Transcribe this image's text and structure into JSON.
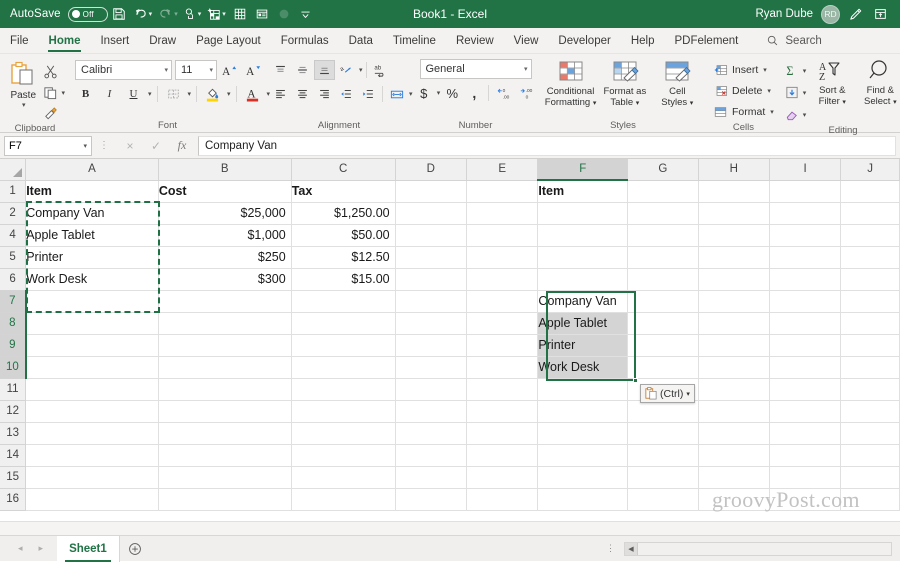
{
  "titlebar": {
    "autosave_label": "AutoSave",
    "autosave_state": "Off",
    "document_title": "Book1  -  Excel",
    "user_name": "Ryan Dube",
    "user_initials": "RD",
    "qat": [
      {
        "name": "save-icon",
        "label": "Save"
      },
      {
        "name": "undo-icon",
        "label": "Undo"
      },
      {
        "name": "redo-icon",
        "label": "Redo"
      },
      {
        "name": "touch-mode-icon",
        "label": "Touch/Mouse Mode"
      },
      {
        "name": "new-icon",
        "label": "New"
      },
      {
        "name": "calculate-icon",
        "label": "Calculate Now"
      },
      {
        "name": "form-icon",
        "label": "Form"
      },
      {
        "name": "record-macro-icon",
        "label": "Record Macro"
      },
      {
        "name": "customize-qat-icon",
        "label": "Customize Quick Access Toolbar"
      }
    ],
    "brand_color": "#217346"
  },
  "tabs": {
    "items": [
      {
        "label": "File",
        "active": false
      },
      {
        "label": "Home",
        "active": true
      },
      {
        "label": "Insert",
        "active": false
      },
      {
        "label": "Draw",
        "active": false
      },
      {
        "label": "Page Layout",
        "active": false
      },
      {
        "label": "Formulas",
        "active": false
      },
      {
        "label": "Data",
        "active": false
      },
      {
        "label": "Timeline",
        "active": false
      },
      {
        "label": "Review",
        "active": false
      },
      {
        "label": "View",
        "active": false
      },
      {
        "label": "Developer",
        "active": false
      },
      {
        "label": "Help",
        "active": false
      },
      {
        "label": "PDFelement",
        "active": false
      }
    ],
    "search_placeholder": "Search"
  },
  "ribbon": {
    "groups": {
      "clipboard": {
        "label": "Clipboard",
        "paste_label": "Paste",
        "cut_label": "Cut",
        "copy_label": "Copy",
        "format_painter_label": "Format Painter"
      },
      "font": {
        "label": "Font",
        "font_name": "Calibri",
        "font_size": "11",
        "grow_label": "A",
        "shrink_label": "A",
        "bold_label": "B",
        "italic_label": "I",
        "underline_label": "U",
        "borders_label": "Borders",
        "fill_color_label": "Fill Color",
        "font_color_label": "A"
      },
      "alignment": {
        "label": "Alignment",
        "orientation_label": "Orientation",
        "wrap_text_label": "Wrap Text",
        "merge_label": "Merge & Center"
      },
      "number": {
        "label": "Number",
        "format": "General",
        "currency_label": "$",
        "percent_label": "%",
        "comma_label": ",",
        "increase_decimal_label": "Increase Decimal",
        "decrease_decimal_label": "Decrease Decimal"
      },
      "styles": {
        "label": "Styles",
        "items": [
          {
            "line1": "Conditional",
            "line2": "Formatting",
            "caret": true
          },
          {
            "line1": "Format as",
            "line2": "Table",
            "caret": true
          },
          {
            "line1": "Cell",
            "line2": "Styles",
            "caret": true
          }
        ]
      },
      "cells": {
        "label": "Cells",
        "items": [
          {
            "label": "Insert",
            "caret": true
          },
          {
            "label": "Delete",
            "caret": true
          },
          {
            "label": "Format",
            "caret": true
          }
        ]
      },
      "editing": {
        "label": "Editing",
        "autosum_label": "AutoSum",
        "fill_label": "Fill",
        "clear_label": "Clear",
        "sort_line1": "Sort &",
        "sort_line2": "Filter",
        "find_line1": "Find &",
        "find_line2": "Select"
      }
    }
  },
  "formula_bar": {
    "name_box": "F7",
    "cancel_label": "×",
    "enter_label": "✓",
    "fx_label": "fx",
    "formula_value": "Company Van"
  },
  "sheet": {
    "columns": [
      {
        "label": "A",
        "width": 134,
        "selected": false
      },
      {
        "label": "B",
        "width": 135,
        "selected": false
      },
      {
        "label": "C",
        "width": 105,
        "selected": false
      },
      {
        "label": "D",
        "width": 73,
        "selected": false
      },
      {
        "label": "E",
        "width": 73,
        "selected": false
      },
      {
        "label": "F",
        "width": 90,
        "selected": true
      },
      {
        "label": "G",
        "width": 72,
        "selected": false
      },
      {
        "label": "H",
        "width": 73,
        "selected": false
      },
      {
        "label": "I",
        "width": 73,
        "selected": false
      },
      {
        "label": "J",
        "width": 60,
        "selected": false
      }
    ],
    "rows": [
      {
        "number": "1",
        "selected": false,
        "cells": [
          {
            "v": "Item",
            "bold": true
          },
          {
            "v": "Cost",
            "bold": true
          },
          {
            "v": "Tax",
            "bold": true
          },
          {
            "v": ""
          },
          {
            "v": ""
          },
          {
            "v": "Item",
            "bold": true
          },
          {
            "v": ""
          },
          {
            "v": ""
          },
          {
            "v": ""
          },
          {
            "v": ""
          }
        ]
      },
      {
        "number": "2",
        "selected": false,
        "cells": [
          {
            "v": "Company Van"
          },
          {
            "v": "$25,000",
            "align": "right"
          },
          {
            "v": "$1,250.00",
            "align": "right"
          },
          {
            "v": ""
          },
          {
            "v": ""
          },
          {
            "v": ""
          },
          {
            "v": ""
          },
          {
            "v": ""
          },
          {
            "v": ""
          },
          {
            "v": ""
          }
        ]
      },
      {
        "number": "4",
        "selected": false,
        "cells": [
          {
            "v": "Apple Tablet"
          },
          {
            "v": "$1,000",
            "align": "right"
          },
          {
            "v": "$50.00",
            "align": "right"
          },
          {
            "v": ""
          },
          {
            "v": ""
          },
          {
            "v": ""
          },
          {
            "v": ""
          },
          {
            "v": ""
          },
          {
            "v": ""
          },
          {
            "v": ""
          }
        ]
      },
      {
        "number": "5",
        "selected": false,
        "cells": [
          {
            "v": "Printer"
          },
          {
            "v": "$250",
            "align": "right"
          },
          {
            "v": "$12.50",
            "align": "right"
          },
          {
            "v": ""
          },
          {
            "v": ""
          },
          {
            "v": ""
          },
          {
            "v": ""
          },
          {
            "v": ""
          },
          {
            "v": ""
          },
          {
            "v": ""
          }
        ]
      },
      {
        "number": "6",
        "selected": false,
        "cells": [
          {
            "v": "Work Desk"
          },
          {
            "v": "$300",
            "align": "right"
          },
          {
            "v": "$15.00",
            "align": "right"
          },
          {
            "v": ""
          },
          {
            "v": ""
          },
          {
            "v": ""
          },
          {
            "v": ""
          },
          {
            "v": ""
          },
          {
            "v": ""
          },
          {
            "v": ""
          }
        ]
      },
      {
        "number": "7",
        "selected": true,
        "cells": [
          {
            "v": ""
          },
          {
            "v": ""
          },
          {
            "v": ""
          },
          {
            "v": ""
          },
          {
            "v": ""
          },
          {
            "v": "Company Van"
          },
          {
            "v": ""
          },
          {
            "v": ""
          },
          {
            "v": ""
          },
          {
            "v": ""
          }
        ]
      },
      {
        "number": "8",
        "selected": true,
        "cells": [
          {
            "v": ""
          },
          {
            "v": ""
          },
          {
            "v": ""
          },
          {
            "v": ""
          },
          {
            "v": ""
          },
          {
            "v": "Apple Tablet",
            "hl": true
          },
          {
            "v": ""
          },
          {
            "v": ""
          },
          {
            "v": ""
          },
          {
            "v": ""
          }
        ]
      },
      {
        "number": "9",
        "selected": true,
        "cells": [
          {
            "v": ""
          },
          {
            "v": ""
          },
          {
            "v": ""
          },
          {
            "v": ""
          },
          {
            "v": ""
          },
          {
            "v": "Printer",
            "hl": true
          },
          {
            "v": ""
          },
          {
            "v": ""
          },
          {
            "v": ""
          },
          {
            "v": ""
          }
        ]
      },
      {
        "number": "10",
        "selected": true,
        "cells": [
          {
            "v": ""
          },
          {
            "v": ""
          },
          {
            "v": ""
          },
          {
            "v": ""
          },
          {
            "v": ""
          },
          {
            "v": "Work Desk",
            "hl": true
          },
          {
            "v": ""
          },
          {
            "v": ""
          },
          {
            "v": ""
          },
          {
            "v": ""
          }
        ]
      },
      {
        "number": "11",
        "selected": false,
        "cells": [
          {
            "v": ""
          },
          {
            "v": ""
          },
          {
            "v": ""
          },
          {
            "v": ""
          },
          {
            "v": ""
          },
          {
            "v": ""
          },
          {
            "v": ""
          },
          {
            "v": ""
          },
          {
            "v": ""
          },
          {
            "v": ""
          }
        ]
      },
      {
        "number": "12",
        "selected": false,
        "cells": [
          {
            "v": ""
          },
          {
            "v": ""
          },
          {
            "v": ""
          },
          {
            "v": ""
          },
          {
            "v": ""
          },
          {
            "v": ""
          },
          {
            "v": ""
          },
          {
            "v": ""
          },
          {
            "v": ""
          },
          {
            "v": ""
          }
        ]
      },
      {
        "number": "13",
        "selected": false,
        "cells": [
          {
            "v": ""
          },
          {
            "v": ""
          },
          {
            "v": ""
          },
          {
            "v": ""
          },
          {
            "v": ""
          },
          {
            "v": ""
          },
          {
            "v": ""
          },
          {
            "v": ""
          },
          {
            "v": ""
          },
          {
            "v": ""
          }
        ]
      },
      {
        "number": "14",
        "selected": false,
        "cells": [
          {
            "v": ""
          },
          {
            "v": ""
          },
          {
            "v": ""
          },
          {
            "v": ""
          },
          {
            "v": ""
          },
          {
            "v": ""
          },
          {
            "v": ""
          },
          {
            "v": ""
          },
          {
            "v": ""
          },
          {
            "v": ""
          }
        ]
      },
      {
        "number": "15",
        "selected": false,
        "cells": [
          {
            "v": ""
          },
          {
            "v": ""
          },
          {
            "v": ""
          },
          {
            "v": ""
          },
          {
            "v": ""
          },
          {
            "v": ""
          },
          {
            "v": ""
          },
          {
            "v": ""
          },
          {
            "v": ""
          },
          {
            "v": ""
          }
        ]
      },
      {
        "number": "16",
        "selected": false,
        "cells": [
          {
            "v": ""
          },
          {
            "v": ""
          },
          {
            "v": ""
          },
          {
            "v": ""
          },
          {
            "v": ""
          },
          {
            "v": ""
          },
          {
            "v": ""
          },
          {
            "v": ""
          },
          {
            "v": ""
          },
          {
            "v": ""
          }
        ]
      }
    ],
    "copy_source_range": "A2:A6",
    "paste_range": "F7:F10",
    "active_cell": "F7",
    "selection_color": "#217346"
  },
  "paste_options": {
    "label": "(Ctrl)",
    "icon": "clipboard-icon"
  },
  "watermark": "groovyPost.com",
  "statusbar": {
    "sheet_tab": "Sheet1",
    "add_sheet_label": "+",
    "prev_label": "◂",
    "next_label": "▸"
  }
}
